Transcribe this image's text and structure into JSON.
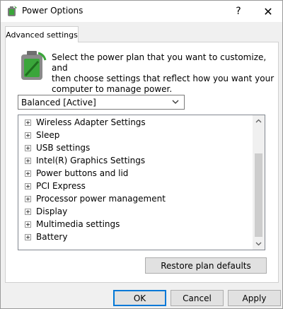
{
  "window": {
    "title": "Power Options",
    "help_glyph": "?",
    "close_glyph": "✕"
  },
  "tab": {
    "label": "Advanced settings"
  },
  "intro": {
    "line1": "Select the power plan that you want to customize, and",
    "line2": "then choose settings that reflect how you want your",
    "line3": "computer to manage power."
  },
  "plan": {
    "selected": "Balanced [Active]"
  },
  "settings_tree": {
    "items": [
      {
        "label": "Wireless Adapter Settings"
      },
      {
        "label": "Sleep"
      },
      {
        "label": "USB settings"
      },
      {
        "label": "Intel(R) Graphics Settings"
      },
      {
        "label": "Power buttons and lid"
      },
      {
        "label": "PCI Express"
      },
      {
        "label": "Processor power management"
      },
      {
        "label": "Display"
      },
      {
        "label": "Multimedia settings"
      },
      {
        "label": "Battery"
      }
    ]
  },
  "buttons": {
    "restore": "Restore plan defaults",
    "ok": "OK",
    "cancel": "Cancel",
    "apply": "Apply"
  },
  "colors": {
    "accent": "#0078d7",
    "icon_green": "#3aa63a",
    "icon_gray": "#7a7a7a"
  },
  "icons": {
    "app": "power-options-icon",
    "settings": "battery-power-icon"
  }
}
